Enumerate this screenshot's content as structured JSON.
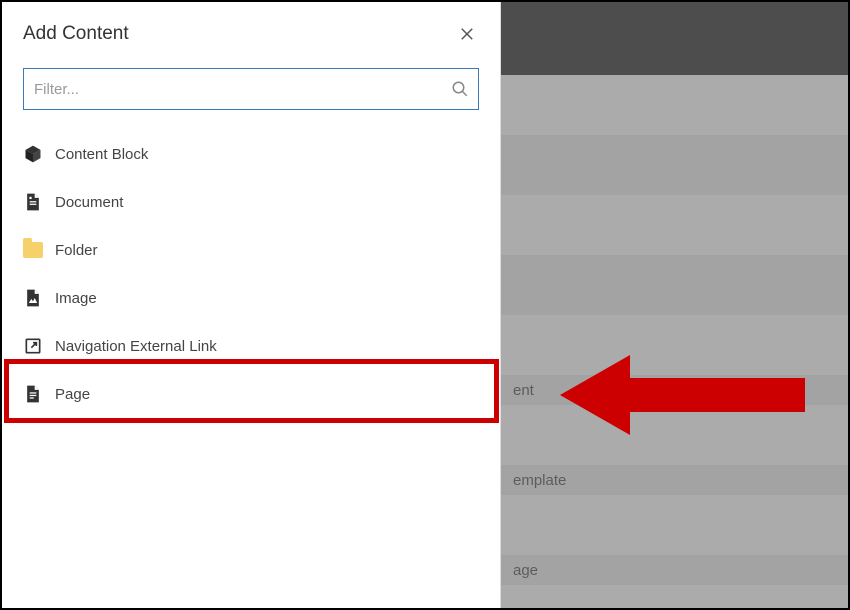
{
  "modal": {
    "title": "Add Content",
    "filter_placeholder": "Filter...",
    "options": {
      "content_block": "Content Block",
      "document": "Document",
      "folder": "Folder",
      "image": "Image",
      "nav_link": "Navigation External Link",
      "page": "Page"
    }
  },
  "background": {
    "row_fragment_1": "ent",
    "row_fragment_2": "emplate",
    "row_fragment_3": "age"
  },
  "annotation": {
    "arrow_color": "#cc0000"
  }
}
